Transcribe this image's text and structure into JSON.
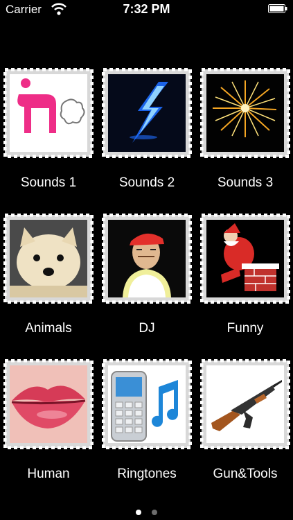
{
  "status_bar": {
    "carrier": "Carrier",
    "time": "7:32 PM",
    "wifi_icon": "wifi-icon",
    "battery_icon": "battery-icon"
  },
  "categories": [
    {
      "label": "Sounds 1",
      "icon": "fart-figure-icon"
    },
    {
      "label": "Sounds 2",
      "icon": "lightning-icon"
    },
    {
      "label": "Sounds 3",
      "icon": "fireworks-icon"
    },
    {
      "label": "Animals",
      "icon": "puppy-icon"
    },
    {
      "label": "DJ",
      "icon": "dj-person-icon"
    },
    {
      "label": "Funny",
      "icon": "santa-chimney-icon"
    },
    {
      "label": "Human",
      "icon": "lips-icon"
    },
    {
      "label": "Ringtones",
      "icon": "phone-music-icon"
    },
    {
      "label": "Gun&Tools",
      "icon": "rifle-icon"
    }
  ],
  "pager": {
    "pages": 2,
    "current": 1
  }
}
